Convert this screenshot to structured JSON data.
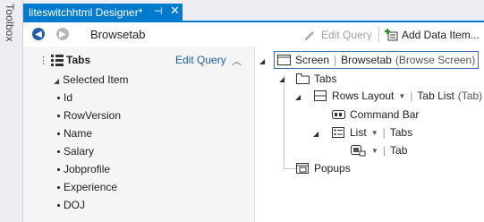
{
  "toolbox": {
    "label": "Toolbox"
  },
  "tab": {
    "title": "liteswitchhtml Designer*",
    "pin_glyph": "⊣",
    "close_glyph": "✕"
  },
  "toolbar": {
    "screen_name": "Browsetab",
    "edit_query_label": "Edit Query",
    "add_data_item_label": "Add Data Item..."
  },
  "left_panel": {
    "title": "Tabs",
    "edit_query_link": "Edit Query",
    "selected_item_label": "Selected Item",
    "fields": [
      "Id",
      "RowVersion",
      "Name",
      "Salary",
      "Jobprofile",
      "Experience",
      "DOJ"
    ]
  },
  "tree": {
    "screen_label": "Screen",
    "screen_name": "Browsetab",
    "screen_type": "(Browse Screen)",
    "tabs_label": "Tabs",
    "rows_layout_label": "Rows Layout",
    "tab_list_label": "Tab List",
    "tab_list_type": "(Tab)",
    "command_bar_label": "Command Bar",
    "list_label": "List",
    "list_source": "Tabs",
    "tab_label": "Tab",
    "popups_label": "Popups"
  },
  "colors": {
    "accent": "#007acc",
    "link": "#1e5fa3",
    "panel_bg": "#f5f5f5"
  }
}
